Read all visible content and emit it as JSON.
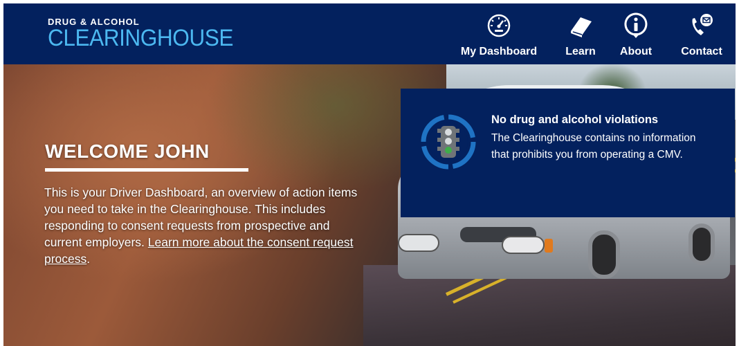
{
  "logo": {
    "top_line": "DRUG & ALCOHOL",
    "main_line": "CLEARINGHOUSE"
  },
  "nav": [
    {
      "label": "My Dashboard",
      "icon": "dashboard-gauge-icon"
    },
    {
      "label": "Learn",
      "icon": "book-icon"
    },
    {
      "label": "About",
      "icon": "info-icon"
    },
    {
      "label": "Contact",
      "icon": "phone-mail-icon"
    }
  ],
  "welcome": {
    "title": "WELCOME JOHN",
    "body": "This is your Driver Dashboard, an overview of action items you need to take in the Clearinghouse. This includes responding to consent requests from prospective and current employers. ",
    "link_text": "Learn more about the consent request process",
    "after_link": "."
  },
  "status": {
    "icon": "traffic-light-icon",
    "title": "No drug and alcohol violations",
    "body": "The Clearinghouse contains no information that prohibits you from operating a CMV."
  },
  "colors": {
    "header_bg": "#03215e",
    "logo_accent": "#4cb8f0",
    "card_bg": "#03215e",
    "traffic_ring": "#1f73c4"
  }
}
